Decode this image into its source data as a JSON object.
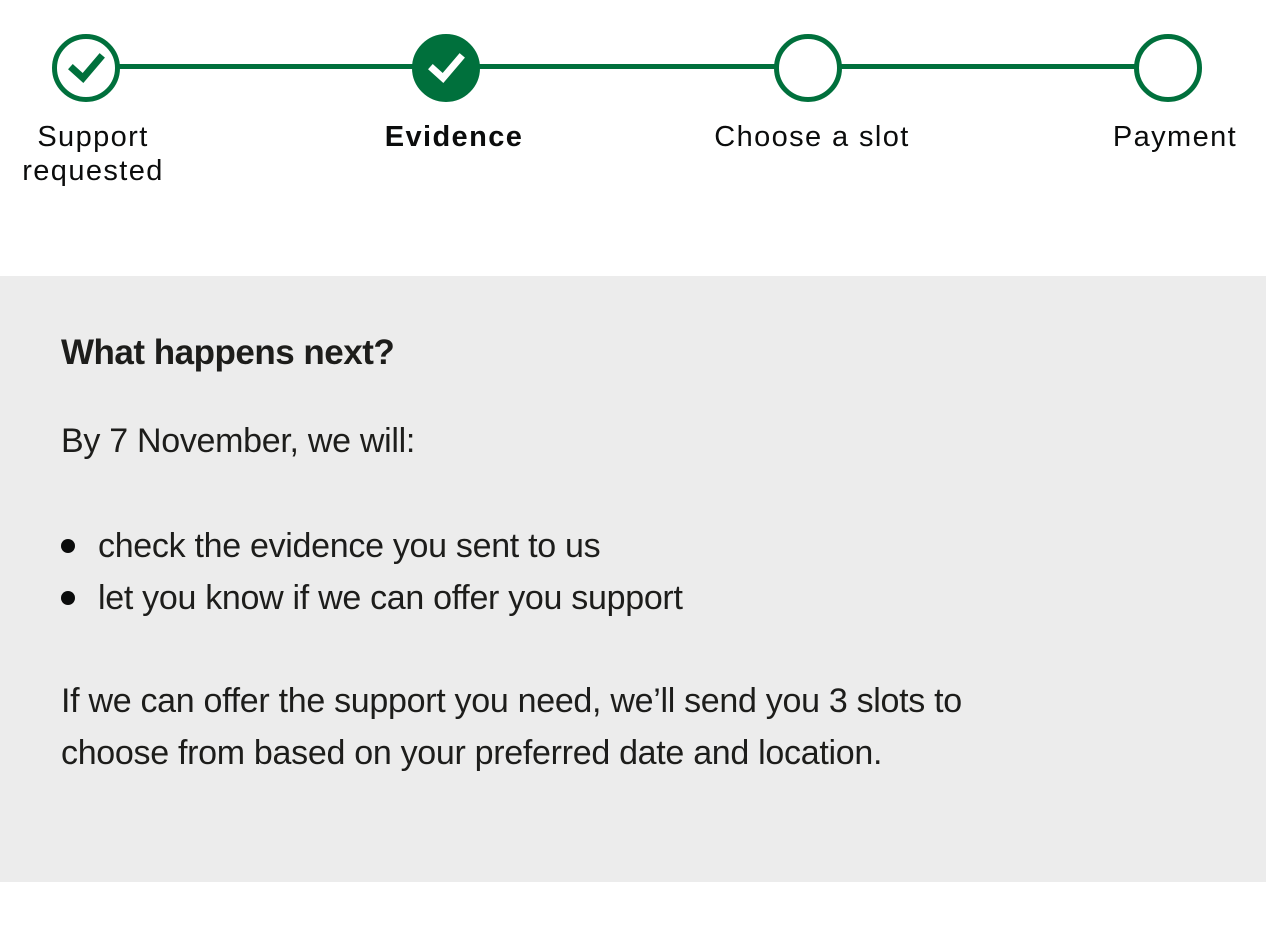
{
  "stepper": {
    "accent_color": "#00703c",
    "steps": [
      {
        "label": "Support requested",
        "status": "complete",
        "icon": "check-icon"
      },
      {
        "label": "Evidence",
        "status": "current-complete",
        "icon": "check-icon"
      },
      {
        "label": "Choose a slot",
        "status": "upcoming",
        "icon": ""
      },
      {
        "label": "Payment",
        "status": "upcoming",
        "icon": ""
      }
    ]
  },
  "panel": {
    "background": "#ececec",
    "heading": "What happens next?",
    "intro": "By 7 November, we will:",
    "bullets": [
      "check the evidence you sent to us",
      "let you know if we can offer you support"
    ],
    "footer_line_1": "If we can offer the support you need, we’ll send you 3 slots to",
    "footer_line_2": "choose from based on your preferred date and location."
  }
}
